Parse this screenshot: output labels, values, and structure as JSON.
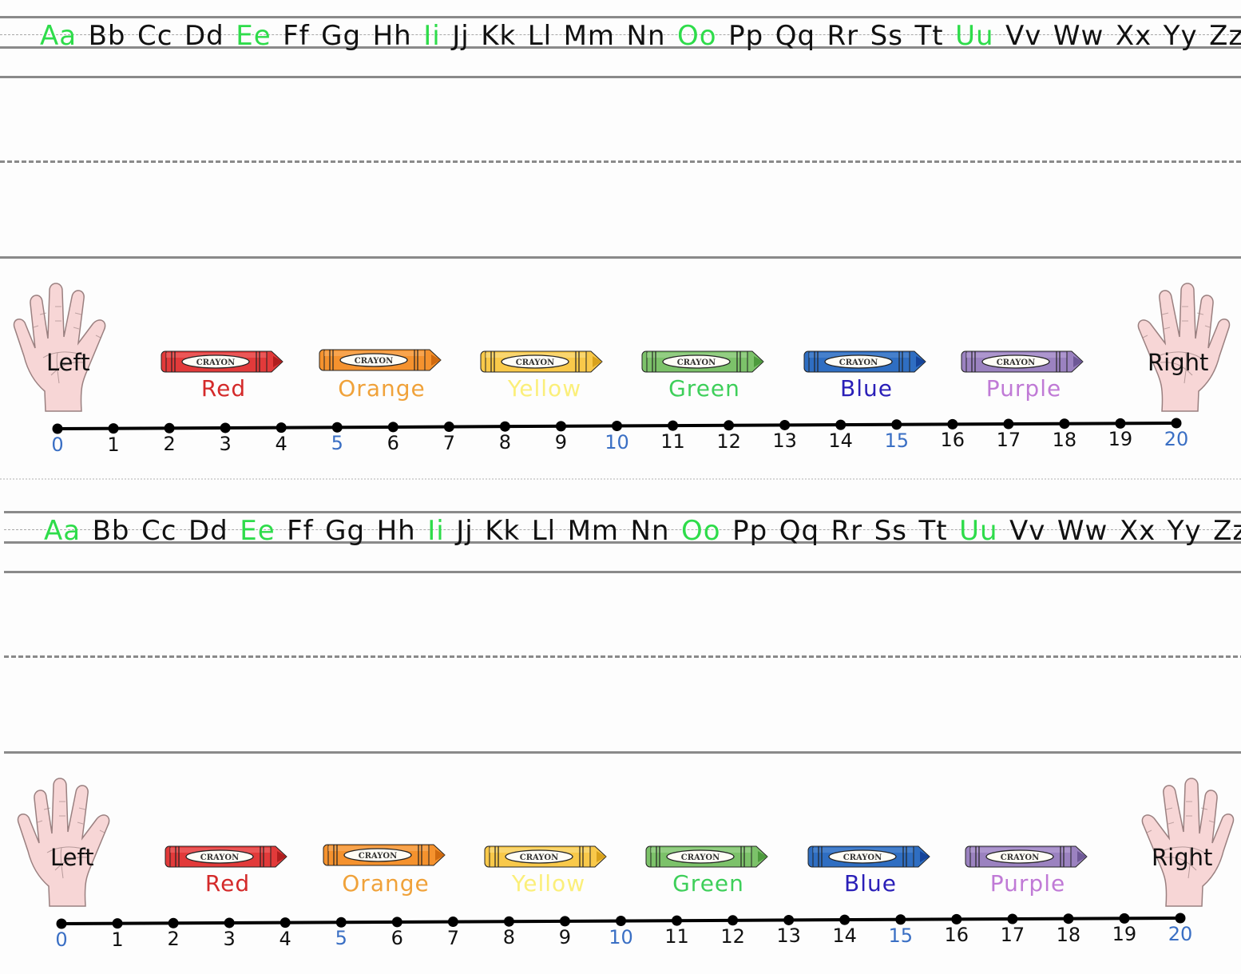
{
  "alphabet": [
    "Aa",
    "Bb",
    "Cc",
    "Dd",
    "Ee",
    "Ff",
    "Gg",
    "Hh",
    "Ii",
    "Jj",
    "Kk",
    "Ll",
    "Mm",
    "Nn",
    "Oo",
    "Pp",
    "Qq",
    "Rr",
    "Ss",
    "Tt",
    "Uu",
    "Vv",
    "Ww",
    "Xx",
    "Yy",
    "Zz"
  ],
  "vowels": [
    "Aa",
    "Ee",
    "Ii",
    "Oo",
    "Uu"
  ],
  "hands": {
    "left_label": "Left",
    "right_label": "Right"
  },
  "crayons": [
    {
      "label": "Red",
      "wrapper_text": "CRAYON",
      "body": "#e23a3a",
      "dark": "#b01e1e",
      "light": "#f27070",
      "text_color": "#d42a2a"
    },
    {
      "label": "Orange",
      "wrapper_text": "CRAYON",
      "body": "#f5922e",
      "dark": "#d06a10",
      "light": "#f9b36a",
      "text_color": "#f0a23a"
    },
    {
      "label": "Yellow",
      "wrapper_text": "CRAYON",
      "body": "#f9c94a",
      "dark": "#d9a21c",
      "light": "#fbe08e",
      "text_color": "#fbef7a"
    },
    {
      "label": "Green",
      "wrapper_text": "CRAYON",
      "body": "#7cc26a",
      "dark": "#4d9a3d",
      "light": "#a6d897",
      "text_color": "#3ecf5a"
    },
    {
      "label": "Blue",
      "wrapper_text": "CRAYON",
      "body": "#2f6ec2",
      "dark": "#16449a",
      "light": "#5a8fd6",
      "text_color": "#2a1fb8"
    },
    {
      "label": "Purple",
      "wrapper_text": "CRAYON",
      "body": "#9b82c0",
      "dark": "#6e5896",
      "light": "#bba8d8",
      "text_color": "#c07ad6"
    }
  ],
  "number_line": {
    "min": 0,
    "max": 20,
    "labels": [
      "0",
      "1",
      "2",
      "3",
      "4",
      "5",
      "6",
      "7",
      "8",
      "9",
      "10",
      "11",
      "12",
      "13",
      "14",
      "15",
      "16",
      "17",
      "18",
      "19",
      "20"
    ],
    "highlight_every": 5,
    "highlight_color": "#3a6fc4"
  },
  "colors": {
    "vowel": "#2edc4a",
    "consonant": "#111111",
    "rule_line": "#8a8a8a",
    "hand_fill": "#f7d6d6",
    "hand_stroke": "#9a8080"
  }
}
